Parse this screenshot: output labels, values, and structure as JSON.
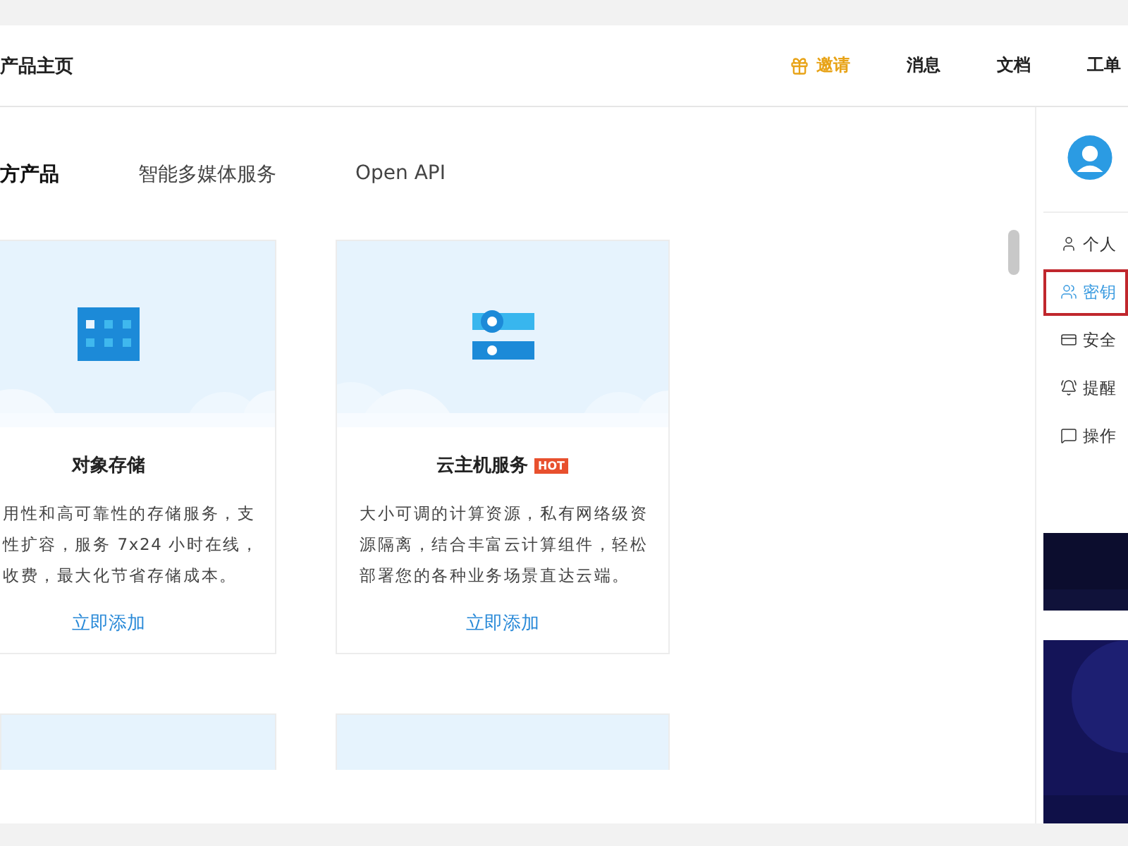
{
  "header": {
    "title": "产品主页",
    "nav": [
      {
        "kind": "invite",
        "label": "邀请"
      },
      {
        "kind": "plain",
        "label": "消息"
      },
      {
        "kind": "plain",
        "label": "文档"
      },
      {
        "kind": "plain",
        "label": "工单"
      }
    ]
  },
  "tabs": [
    {
      "label": "方产品",
      "selected": true
    },
    {
      "label": "智能多媒体服务",
      "selected": false
    },
    {
      "label": "Open API",
      "selected": false
    }
  ],
  "cards": [
    {
      "kind": "storage",
      "cut": true,
      "title": "对象存储",
      "description": [
        "用性和高可靠性的存储服务，支",
        "性扩容，服务 7x24 小时在线，",
        "收费，最大化节省存储成本。"
      ],
      "action": "立即添加"
    },
    {
      "kind": "server",
      "cut": false,
      "title": "云主机服务",
      "badge": "HOT",
      "description": [
        "大小可调的计算资源，私有网络级资",
        "源隔离，结合丰富云计算组件，轻松",
        "部署您的各种业务场景直达云端。"
      ],
      "action": "立即添加"
    }
  ],
  "more_cards": [
    {
      "kind": "placeholder"
    },
    {
      "kind": "placeholder"
    }
  ],
  "side_menu": [
    {
      "kind": "user",
      "label": "个人",
      "selected": false
    },
    {
      "kind": "key",
      "label": "密钥",
      "selected": true
    },
    {
      "kind": "card",
      "label": "安全",
      "selected": false
    },
    {
      "kind": "bell",
      "label": "提醒",
      "selected": false
    },
    {
      "kind": "log",
      "label": "操作",
      "selected": false
    }
  ]
}
